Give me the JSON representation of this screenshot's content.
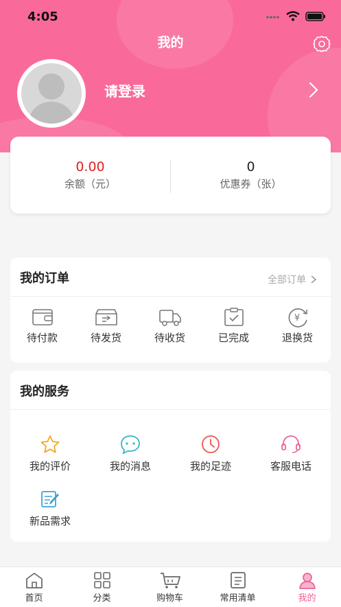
{
  "status_bar": {
    "time": "4:05"
  },
  "header": {
    "title": "我的",
    "login_text": "请登录"
  },
  "balance": {
    "amount": "0.00",
    "amount_label": "余额（元）",
    "coupons": "0",
    "coupons_label": "优惠券（张）",
    "amount_color": "#e02020"
  },
  "orders": {
    "title": "我的订单",
    "all_label": "全部订单",
    "items": [
      {
        "label": "待付款",
        "icon": "wallet-icon"
      },
      {
        "label": "待发货",
        "icon": "shipping-box-icon"
      },
      {
        "label": "待收货",
        "icon": "truck-icon"
      },
      {
        "label": "已完成",
        "icon": "clipboard-check-icon"
      },
      {
        "label": "退换货",
        "icon": "refund-icon"
      }
    ]
  },
  "services": {
    "title": "我的服务",
    "items": [
      {
        "label": "我的评价",
        "icon": "star-icon",
        "color": "#f5a623"
      },
      {
        "label": "我的消息",
        "icon": "chat-icon",
        "color": "#2fb7c8"
      },
      {
        "label": "我的足迹",
        "icon": "clock-icon",
        "color": "#ef5350"
      },
      {
        "label": "客服电话",
        "icon": "headset-icon",
        "color": "#f0609a"
      },
      {
        "label": "新品需求",
        "icon": "edit-note-icon",
        "color": "#3ba3d8"
      }
    ]
  },
  "tabbar": {
    "items": [
      {
        "label": "首页",
        "icon": "home-icon"
      },
      {
        "label": "分类",
        "icon": "category-icon"
      },
      {
        "label": "购物车",
        "icon": "cart-icon"
      },
      {
        "label": "常用清单",
        "icon": "list-icon"
      },
      {
        "label": "我的",
        "icon": "user-icon",
        "active": true
      }
    ]
  },
  "colors": {
    "brand": "#f96a9a",
    "active_tab": "#f0609a"
  }
}
